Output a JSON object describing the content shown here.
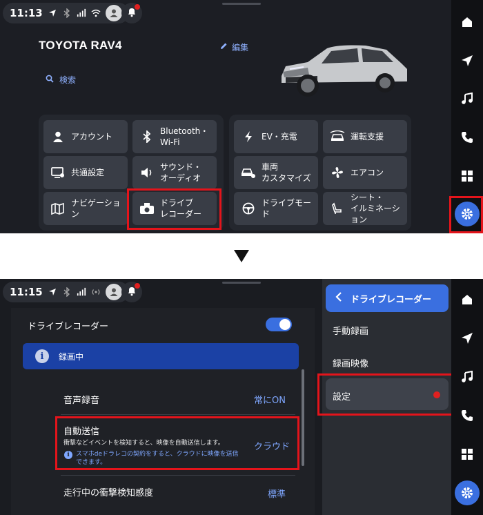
{
  "screen1": {
    "status": {
      "time": "11:13"
    },
    "vehicle": {
      "name": "TOYOTA RAV4",
      "edit_label": "編集",
      "search_label": "検索"
    },
    "tiles_left": [
      {
        "label": "アカウント",
        "icon": "person-icon"
      },
      {
        "label": "Bluetooth・\nWi-Fi",
        "icon": "bluetooth-icon"
      },
      {
        "label": "共通設定",
        "icon": "display-settings-icon"
      },
      {
        "label": "サウンド・\nオーディオ",
        "icon": "speaker-icon"
      },
      {
        "label": "ナビゲーション",
        "icon": "map-icon"
      },
      {
        "label": "ドライブ\nレコーダー",
        "icon": "camera-icon"
      }
    ],
    "tiles_right": [
      {
        "label": "EV・充電",
        "icon": "bolt-icon"
      },
      {
        "label": "運転支援",
        "icon": "driving-assist-icon"
      },
      {
        "label": "車両\nカスタマイズ",
        "icon": "car-settings-icon"
      },
      {
        "label": "エアコン",
        "icon": "fan-icon"
      },
      {
        "label": "ドライブモード",
        "icon": "steering-wheel-icon"
      },
      {
        "label": "シート・\nイルミネーション",
        "icon": "seat-icon"
      }
    ]
  },
  "screen2": {
    "status": {
      "time": "11:15"
    },
    "section_title": "ドライブレコーダー",
    "banner_text": "録画中",
    "rows": {
      "audio_label": "音声録音",
      "audio_value": "常にON",
      "auto_send_label": "自動送信",
      "auto_send_desc": "衝撃などイベントを検知すると、映像を自動送信します。",
      "auto_send_value": "クラウド",
      "auto_send_note": "スマホdeドラレコの契約をすると、クラウドに映像を送信できます。",
      "shock_label": "走行中の衝撃検知感度",
      "shock_value": "標準"
    },
    "menu": {
      "header": "ドライブレコーダー",
      "items": [
        "手動録画",
        "録画映像",
        "設定"
      ]
    }
  },
  "rail": [
    "home-icon",
    "navigation-icon",
    "music-icon",
    "phone-icon",
    "apps-icon",
    "settings-gear-icon"
  ],
  "colors": {
    "accent": "#3a6fe0",
    "highlight": "#e4141b",
    "banner": "#1b41a5",
    "link": "#8fb1ff"
  }
}
